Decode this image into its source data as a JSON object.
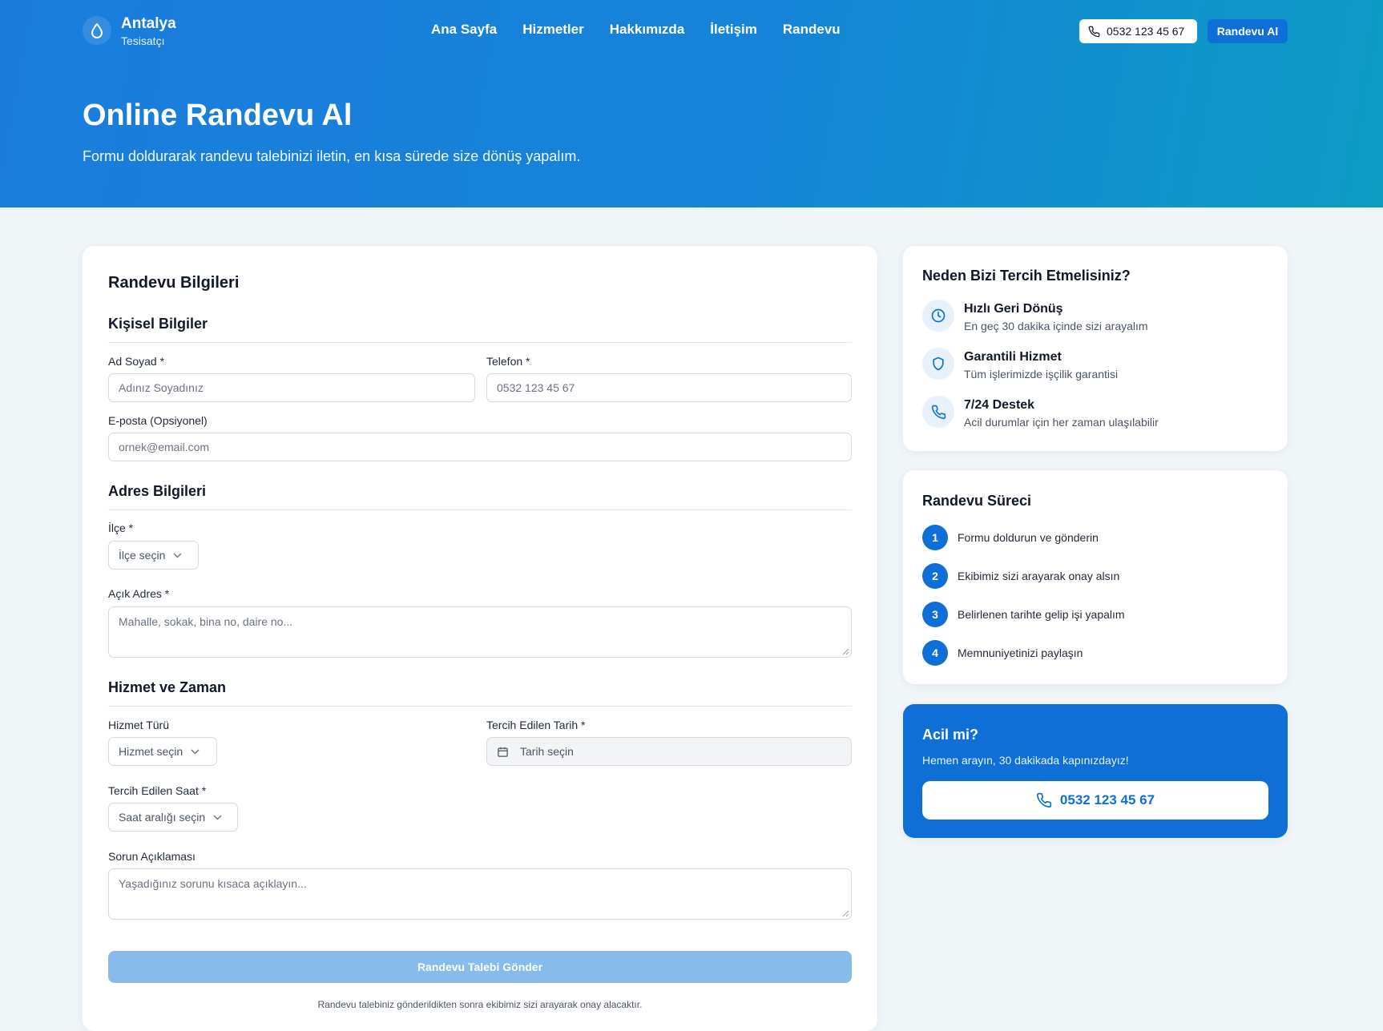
{
  "brand": {
    "title": "Antalya",
    "subtitle": "Tesisatçı",
    "icon": "water-drop-icon"
  },
  "nav": {
    "items": [
      "Ana Sayfa",
      "Hizmetler",
      "Hakkımızda",
      "İletişim",
      "Randevu"
    ],
    "phone": "0532 123 45 67",
    "cta": "Randevu Al"
  },
  "hero": {
    "title": "Online Randevu Al",
    "subtitle": "Formu doldurarak randevu talebinizi iletin, en kısa sürede size dönüş yapalım."
  },
  "form": {
    "title": "Randevu Bilgileri",
    "personal": {
      "title": "Kişisel Bilgiler",
      "name_label": "Ad Soyad *",
      "name_placeholder": "Adınız Soyadınız",
      "phone_label": "Telefon *",
      "phone_placeholder": "0532 123 45 67",
      "email_label": "E-posta (Opsiyonel)",
      "email_placeholder": "ornek@email.com"
    },
    "address": {
      "title": "Adres Bilgileri",
      "district_label": "İlçe *",
      "district_value": "İlçe seçin",
      "address_label": "Açık Adres *",
      "address_placeholder": "Mahalle, sokak, bina no, daire no..."
    },
    "service": {
      "title": "Hizmet ve Zaman",
      "type_label": "Hizmet Türü",
      "type_value": "Hizmet seçin",
      "date_label": "Tercih Edilen Tarih *",
      "date_placeholder": "Tarih seçin",
      "time_label": "Tercih Edilen Saat *",
      "time_value": "Saat aralığı seçin",
      "desc_label": "Sorun Açıklaması",
      "desc_placeholder": "Yaşadığınız sorunu kısaca açıklayın..."
    },
    "submit": "Randevu Talebi Gönder",
    "footnote": "Randevu talebiniz gönderildikten sonra ekibimiz sizi arayarak onay alacaktır."
  },
  "why": {
    "title": "Neden Bizi Tercih Etmelisiniz?",
    "features": [
      {
        "title": "Hızlı Geri Dönüş",
        "desc": "En geç 30 dakika içinde sizi arayalım",
        "icon": "clock-icon"
      },
      {
        "title": "Garantili Hizmet",
        "desc": "Tüm işlerimizde işçilik garantisi",
        "icon": "shield-icon"
      },
      {
        "title": "7/24 Destek",
        "desc": "Acil durumlar için her zaman ulaşılabilir",
        "icon": "phone-icon"
      }
    ]
  },
  "process": {
    "title": "Randevu Süreci",
    "steps": [
      {
        "num": "1",
        "text": "Formu doldurun ve gönderin"
      },
      {
        "num": "2",
        "text": "Ekibimiz sizi arayarak onay alsın"
      },
      {
        "num": "3",
        "text": "Belirlenen tarihte gelip işi yapalım"
      },
      {
        "num": "4",
        "text": "Memnuniyetinizi paylaşın"
      }
    ]
  },
  "urgent": {
    "title": "Acil mi?",
    "subtitle": "Hemen arayın, 30 dakikada kapınızdayız!",
    "phone": "0532 123 45 67"
  },
  "colors": {
    "primary": "#0e6fd6",
    "hero_start": "#1a7ddc",
    "hero_end": "#0c9cc4",
    "submit_disabled": "#86bbea"
  }
}
